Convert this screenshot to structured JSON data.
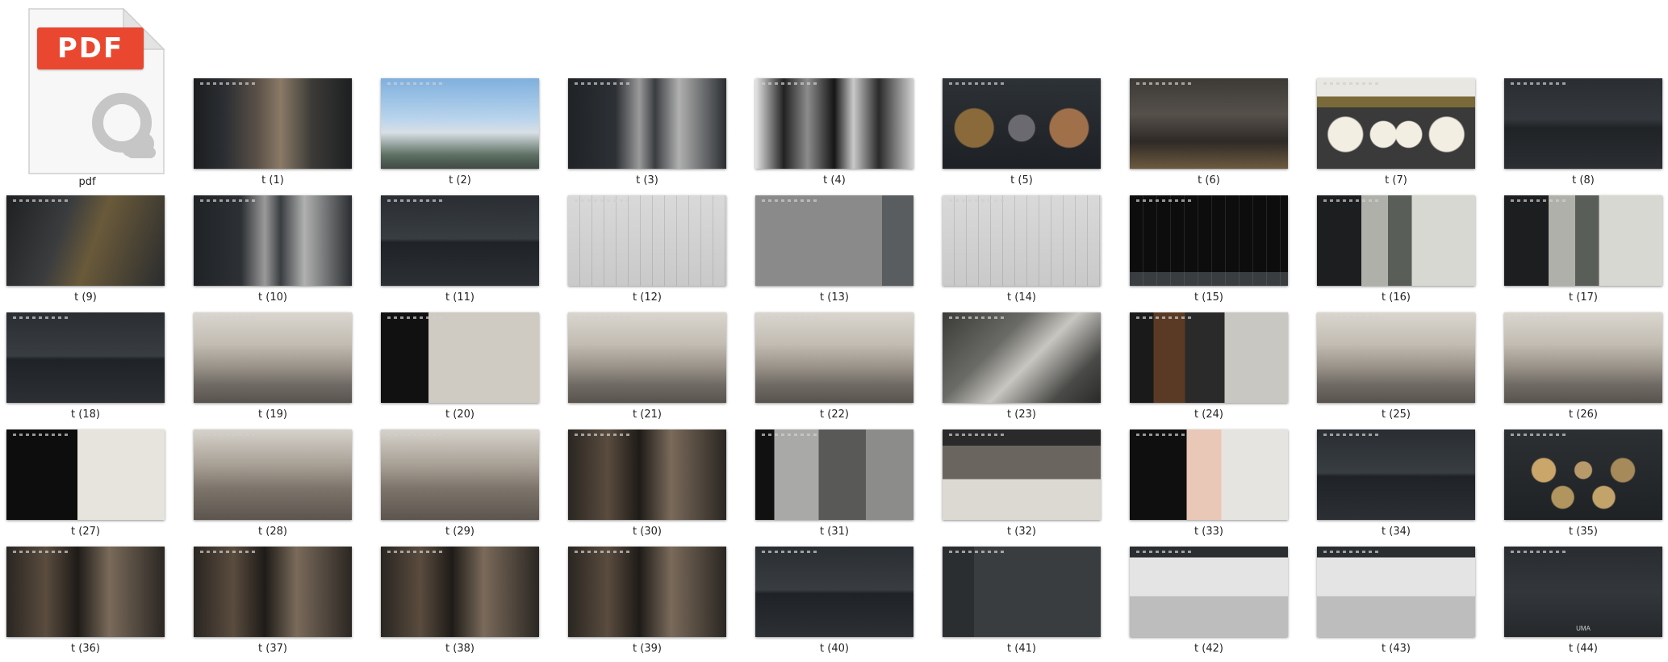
{
  "pdf_file": {
    "badge": "PDF",
    "caption": "pdf",
    "colors": {
      "badge": "#e9472f",
      "logo": "#c6c6c6"
    }
  },
  "thumbnails": [
    {
      "label": "t (1)",
      "overlay": "",
      "style": "dark-arch"
    },
    {
      "label": "t (2)",
      "overlay": "",
      "style": "sky"
    },
    {
      "label": "t (3)",
      "overlay": "",
      "style": "dark-people"
    },
    {
      "label": "t (4)",
      "overlay": "",
      "style": "bw"
    },
    {
      "label": "t (5)",
      "overlay": "",
      "style": "dark-circles"
    },
    {
      "label": "t (6)",
      "overlay": "",
      "style": "city-night"
    },
    {
      "label": "t (7)",
      "overlay": "",
      "style": "light-circles"
    },
    {
      "label": "t (8)",
      "overlay": "",
      "style": "dark-plain"
    },
    {
      "label": "t (9)",
      "overlay": "",
      "style": "dark-gold"
    },
    {
      "label": "t (10)",
      "overlay": "",
      "style": "dark-people"
    },
    {
      "label": "t (11)",
      "overlay": "",
      "style": "dark-title"
    },
    {
      "label": "t (12)",
      "overlay": "",
      "style": "plan-light"
    },
    {
      "label": "t (13)",
      "overlay": "",
      "style": "plan-grey"
    },
    {
      "label": "t (14)",
      "overlay": "",
      "style": "plan-light"
    },
    {
      "label": "t (15)",
      "overlay": "",
      "style": "plan-dark"
    },
    {
      "label": "t (16)",
      "overlay": "",
      "style": "interior-dark"
    },
    {
      "label": "t (17)",
      "overlay": "",
      "style": "interior-dark"
    },
    {
      "label": "t (18)",
      "overlay": "",
      "style": "dark-title"
    },
    {
      "label": "t (19)",
      "overlay": "",
      "style": "room-light"
    },
    {
      "label": "t (20)",
      "overlay": "",
      "style": "room-mix"
    },
    {
      "label": "t (21)",
      "overlay": "",
      "style": "room-light"
    },
    {
      "label": "t (22)",
      "overlay": "",
      "style": "room-light"
    },
    {
      "label": "t (23)",
      "overlay": "",
      "style": "room-dark"
    },
    {
      "label": "t (24)",
      "overlay": "",
      "style": "wood"
    },
    {
      "label": "t (25)",
      "overlay": "",
      "style": "room-light"
    },
    {
      "label": "t (26)",
      "overlay": "",
      "style": "room-light"
    },
    {
      "label": "t (27)",
      "overlay": "",
      "style": "chair"
    },
    {
      "label": "t (28)",
      "overlay": "",
      "style": "bedroom"
    },
    {
      "label": "t (29)",
      "overlay": "",
      "style": "bedroom"
    },
    {
      "label": "t (30)",
      "overlay": "",
      "style": "closet"
    },
    {
      "label": "t (31)",
      "overlay": "",
      "style": "bath"
    },
    {
      "label": "t (32)",
      "overlay": "",
      "style": "bedroom-dark"
    },
    {
      "label": "t (33)",
      "overlay": "",
      "style": "flowers"
    },
    {
      "label": "t (34)",
      "overlay": "",
      "style": "dark-title"
    },
    {
      "label": "t (35)",
      "overlay": "",
      "style": "hex"
    },
    {
      "label": "t (36)",
      "overlay": "",
      "style": "closet"
    },
    {
      "label": "t (37)",
      "overlay": "",
      "style": "closet"
    },
    {
      "label": "t (38)",
      "overlay": "",
      "style": "closet"
    },
    {
      "label": "t (39)",
      "overlay": "",
      "style": "closet"
    },
    {
      "label": "t (40)",
      "overlay": "",
      "style": "dark-title"
    },
    {
      "label": "t (41)",
      "overlay": "",
      "style": "diagram"
    },
    {
      "label": "t (42)",
      "overlay": "",
      "style": "appliance"
    },
    {
      "label": "t (43)",
      "overlay": "",
      "style": "appliance"
    },
    {
      "label": "t (44)",
      "overlay": "UMA",
      "style": "dark-end"
    }
  ]
}
